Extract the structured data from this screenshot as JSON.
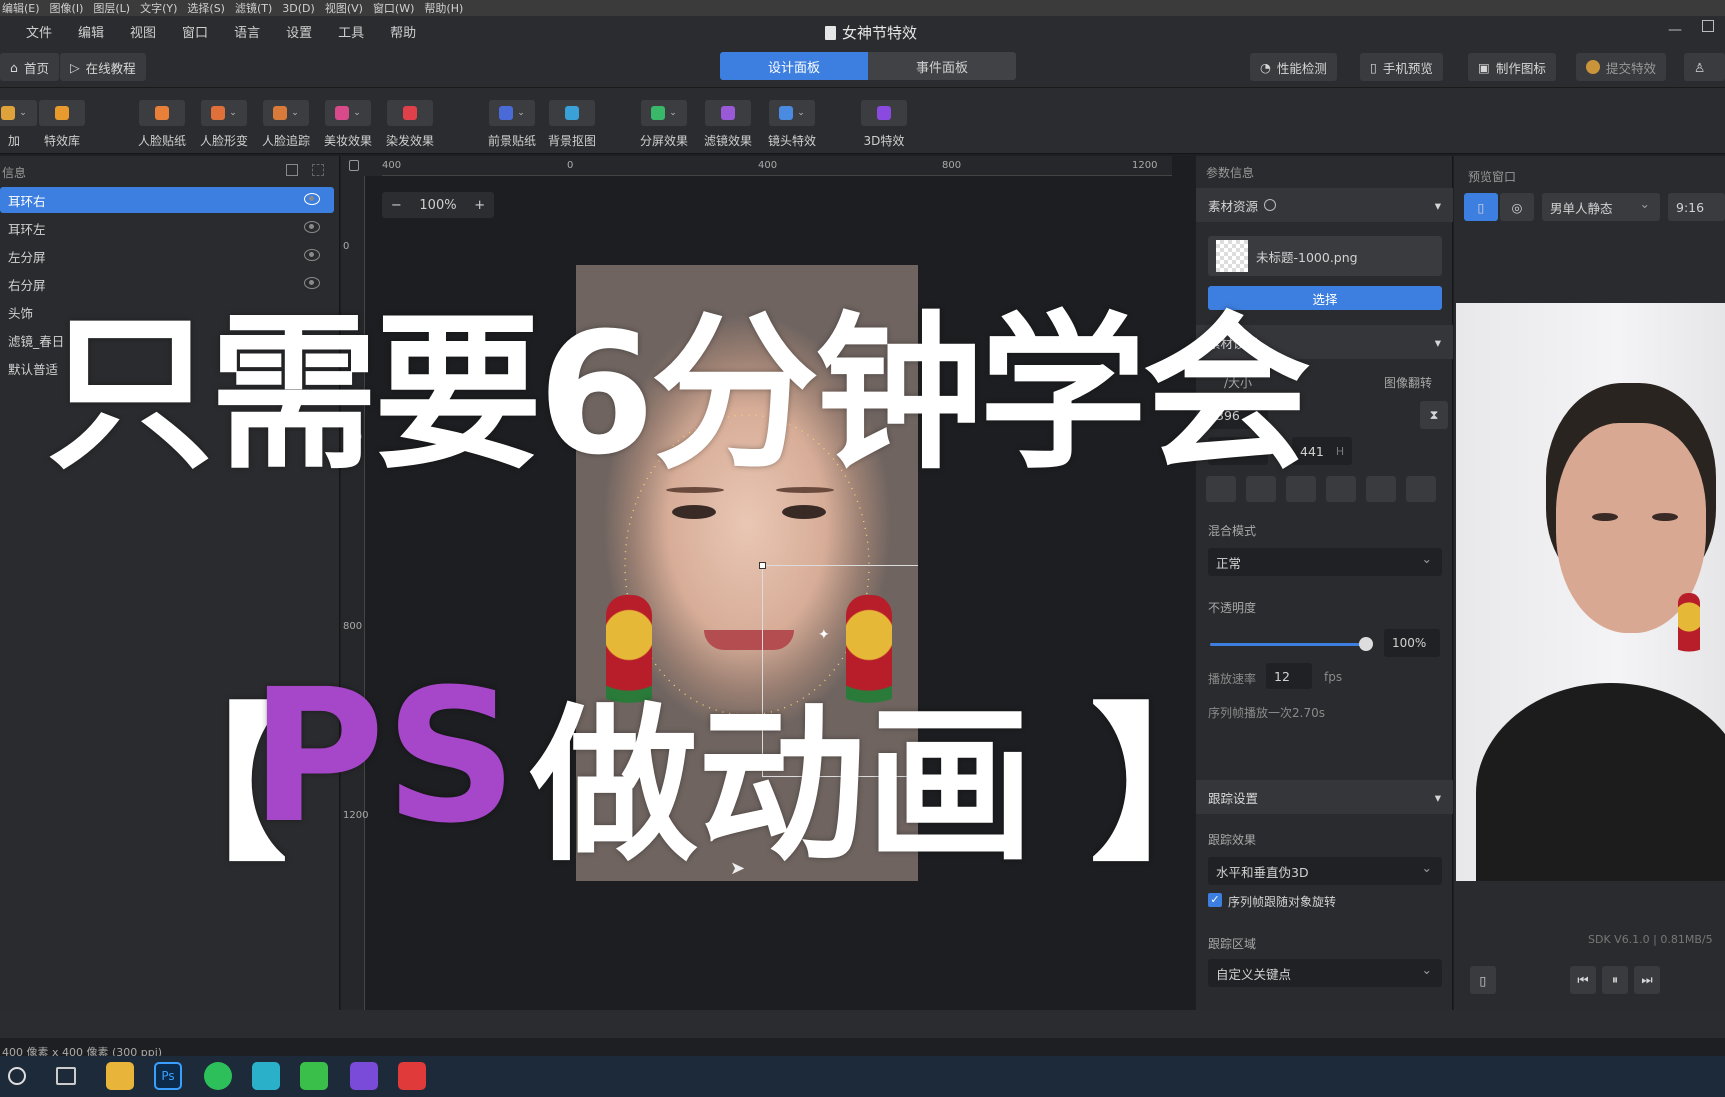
{
  "ps_menu": [
    "编辑(E)",
    "图像(I)",
    "图层(L)",
    "文字(Y)",
    "选择(S)",
    "滤镜(T)",
    "3D(D)",
    "视图(V)",
    "窗口(W)",
    "帮助(H)"
  ],
  "app_menu": [
    "文件",
    "编辑",
    "视图",
    "窗口",
    "语言",
    "设置",
    "工具",
    "帮助"
  ],
  "doc_title": "女神节特效",
  "top": {
    "home": "首页",
    "tutorial": "在线教程",
    "tab_design": "设计面板",
    "tab_event": "事件面板",
    "perf": "性能检测",
    "phone_preview": "手机预览",
    "make_icon": "制作图标",
    "submit": "提交特效"
  },
  "toolbar": [
    {
      "label": "加",
      "color": "#e0a23a"
    },
    {
      "label": "特效库",
      "color": "#e89a2c"
    },
    {
      "label": "人脸贴纸",
      "color": "#e8803a"
    },
    {
      "label": "人脸形变",
      "color": "#e0703a"
    },
    {
      "label": "人脸追踪",
      "color": "#d87a3a"
    },
    {
      "label": "美妆效果",
      "color": "#d84a8a"
    },
    {
      "label": "染发效果",
      "color": "#e0404a"
    },
    {
      "label": "前景贴纸",
      "color": "#4a6ad8"
    },
    {
      "label": "背景抠图",
      "color": "#3aa0d8"
    },
    {
      "label": "分屏效果",
      "color": "#3ab86a"
    },
    {
      "label": "滤镜效果",
      "color": "#9a5ad8"
    },
    {
      "label": "镜头特效",
      "color": "#4a8ae0"
    },
    {
      "label": "3D特效",
      "color": "#8a4ae0"
    }
  ],
  "layers": {
    "header": "信息",
    "items": [
      "耳环右",
      "耳环左",
      "左分屏",
      "右分屏",
      "头饰",
      "滤镜_春日",
      "默认普适"
    ]
  },
  "canvas": {
    "zoom": "100%",
    "ruler_top": [
      "400",
      "0",
      "400",
      "800",
      "1200"
    ],
    "ruler_left": [
      "0",
      "400",
      "800",
      "1200"
    ]
  },
  "params": {
    "header": "参数信息",
    "material_section": "素材资源",
    "file_name": "未标题-1000.png",
    "choose_btn": "选择",
    "settings_section": "素材设置",
    "size_label": "/大小",
    "flip_label": "图像翻转",
    "pos_x": "396",
    "w": "441",
    "w_unit": "W",
    "h": "441",
    "h_unit": "H",
    "blend_label": "混合模式",
    "blend_value": "正常",
    "opacity_label": "不透明度",
    "opacity_value": "100%",
    "opacity_fraction": 1.0,
    "rate_label": "播放速率",
    "rate_value": "12",
    "rate_unit": "fps",
    "seq_note": "序列帧播放一次2.70s",
    "tracking_section": "跟踪设置",
    "track_effect_label": "跟踪效果",
    "track_effect_value": "水平和垂直伪3D",
    "track_check": "序列帧跟随对象旋转",
    "track_area_label": "跟踪区域",
    "track_area_value": "自定义关键点"
  },
  "preview": {
    "header": "预览窗口",
    "model": "男单人静态",
    "ratio": "9:16",
    "sdk": "SDK V6.1.0  |  0.81MB/5"
  },
  "status": "400 像素 x 400 像素 (300 ppi)",
  "overlay": {
    "line1": "只需要6分钟学会",
    "bracket_left": "【",
    "ps": "PS",
    "line2_rest": "做动画",
    "bracket_right": "】",
    "ps_color": "#a646c8"
  }
}
